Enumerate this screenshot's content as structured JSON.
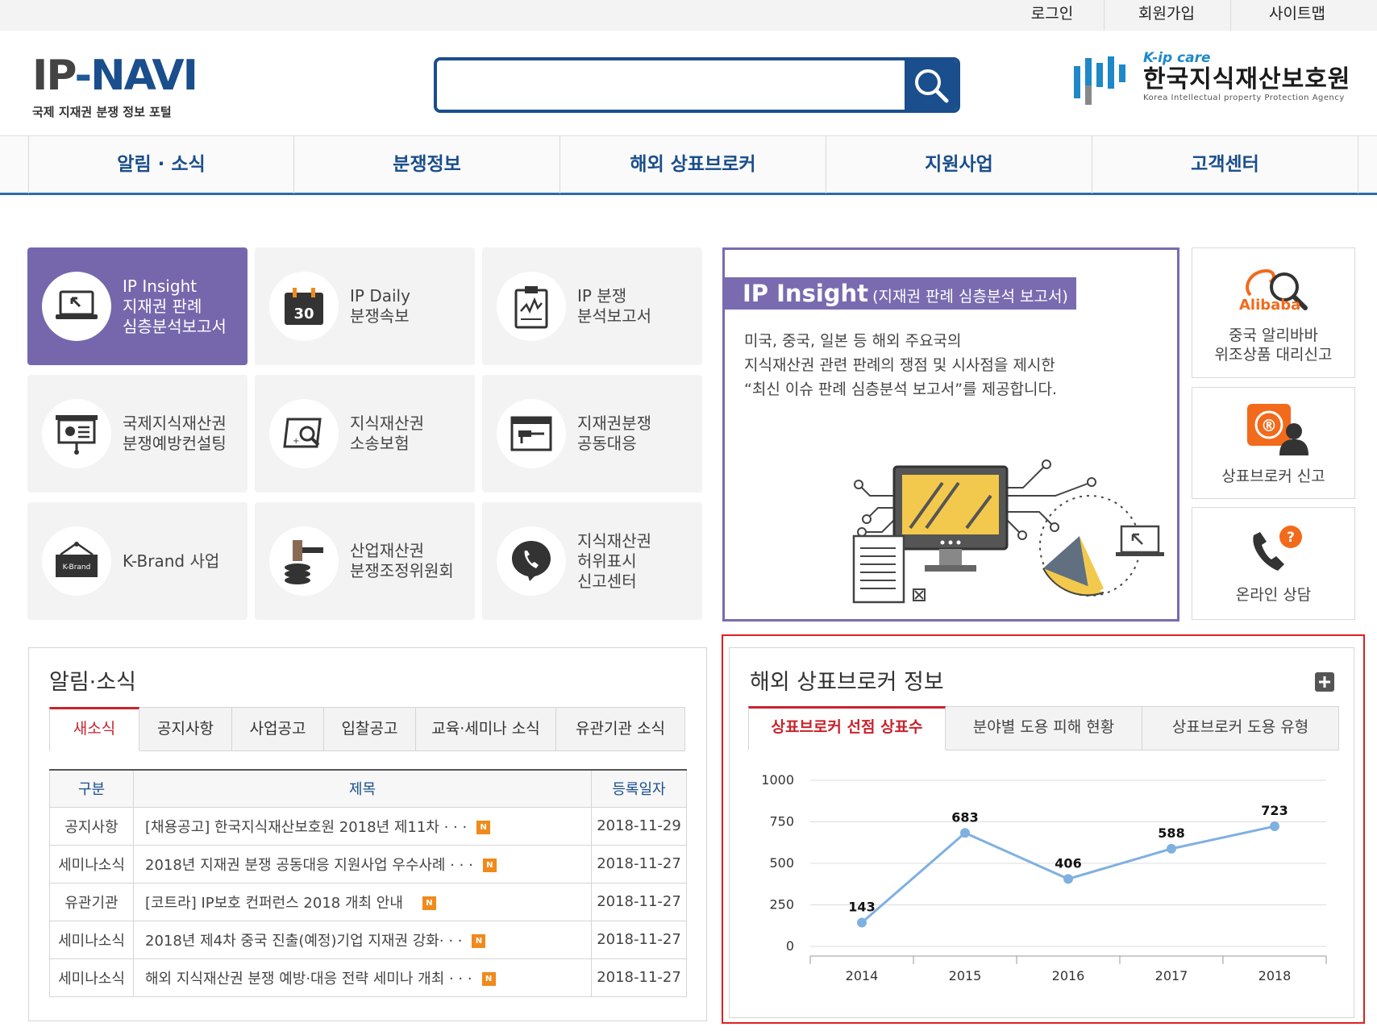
{
  "util_links": [
    "로그인",
    "회원가입",
    "사이트맵"
  ],
  "logo": {
    "main_ip": "IP",
    "main_navi": "NAVI",
    "subtitle": "국제 지재권 분쟁 정보 포털"
  },
  "search": {
    "placeholder": ""
  },
  "agency": {
    "en_short": "K-ip care",
    "name_ko": "한국지식재산보호원",
    "name_en": "Korea Intellectual property Protection Agency"
  },
  "nav": [
    "알림 · 소식",
    "분쟁정보",
    "해외 상표브로커",
    "지원사업",
    "고객센터"
  ],
  "tiles": [
    {
      "icon": "monitor-icon",
      "lines": [
        "IP Insight",
        "지재권 판례",
        "심층분석보고서"
      ]
    },
    {
      "icon": "calendar-icon",
      "calendar_day": "30",
      "lines": [
        "IP Daily",
        "분쟁속보"
      ]
    },
    {
      "icon": "clipboard-chart-icon",
      "lines": [
        "IP 분쟁",
        "분석보고서"
      ]
    },
    {
      "icon": "presentation-board-icon",
      "lines": [
        "국제지식재산권",
        "분쟁예방컨설팅"
      ]
    },
    {
      "icon": "magnifier-document-icon",
      "lines": [
        "지식재산권",
        "소송보험"
      ]
    },
    {
      "icon": "browser-window-icon",
      "lines": [
        "지재권분쟁",
        "공동대응"
      ]
    },
    {
      "icon": "k-brand-sign-icon",
      "sign_text": "K-Brand",
      "lines": [
        "K-Brand 사업"
      ]
    },
    {
      "icon": "gavel-icon",
      "lines": [
        "산업재산권",
        "분쟁조정위원회"
      ]
    },
    {
      "icon": "phone-bubble-icon",
      "lines": [
        "지식재산권",
        "허위표시",
        "신고센터"
      ]
    }
  ],
  "insight": {
    "title_big": "IP Insight",
    "title_small": "(지재권 판례 심층분석 보고서)",
    "desc": [
      "미국, 중국, 일본 등 해외 주요국의",
      "지식재산권 관련 판례의 쟁점 및 시사점을 제시한",
      "“최신 이슈 판례 심층분석 보고서”를 제공합니다."
    ]
  },
  "quick_menu": [
    {
      "icon": "alibaba-magnifier-icon",
      "logo_text": "Alibaba",
      "lines": [
        "중국 알리바바",
        "위조상품 대리신고"
      ]
    },
    {
      "icon": "registered-person-icon",
      "badge_text": "®",
      "lines": [
        "상표브로커 신고"
      ]
    },
    {
      "icon": "phone-question-icon",
      "badge_text": "?",
      "lines": [
        "온라인 상담"
      ]
    }
  ],
  "board": {
    "title": "알림·소식",
    "tabs": [
      "새소식",
      "공지사항",
      "사업공고",
      "입찰공고",
      "교육·세미나 소식",
      "유관기관 소식"
    ],
    "active_tab": 0,
    "columns": [
      "구분",
      "제목",
      "등록일자"
    ],
    "new_badge": "N",
    "rows": [
      {
        "category": "공지사항",
        "title": "[채용공고] 한국지식재산보호원 2018년 제11차 · · ·",
        "date": "2018-11-29"
      },
      {
        "category": "세미나소식",
        "title": "2018년 지재권 분쟁 공동대응 지원사업 우수사례 · · ·",
        "date": "2018-11-27"
      },
      {
        "category": "유관기관",
        "title": "[코트라] IP보호 컨퍼런스 2018 개최 안내",
        "date": "2018-11-27"
      },
      {
        "category": "세미나소식",
        "title": "2018년 제4차 중국 진출(예정)기업 지재권 강화· · ·",
        "date": "2018-11-27"
      },
      {
        "category": "세미나소식",
        "title": "해외 지식재산권 분쟁 예방·대응 전략 세미나 개최 · · ·",
        "date": "2018-11-27"
      }
    ]
  },
  "broker": {
    "title": "해외 상표브로커 정보",
    "tabs": [
      "상표브로커 선점 상표수",
      "분야별 도용 피해 현황",
      "상표브로커 도용 유형"
    ],
    "active_tab": 0
  },
  "colors": {
    "brand_blue": "#1a4e8c",
    "purple": "#7a6bb0",
    "active_red": "#c8232c",
    "highlight_border": "#e02020",
    "chart_line": "#7fb0e0"
  },
  "chart_data": {
    "type": "line",
    "title": "",
    "xlabel": "",
    "ylabel": "",
    "x": [
      "2014",
      "2015",
      "2016",
      "2017",
      "2018"
    ],
    "values": [
      143,
      683,
      406,
      588,
      723
    ],
    "ylim": [
      0,
      1000
    ],
    "yticks": [
      0,
      250,
      500,
      750,
      1000
    ],
    "grid": true,
    "data_labels": true
  }
}
